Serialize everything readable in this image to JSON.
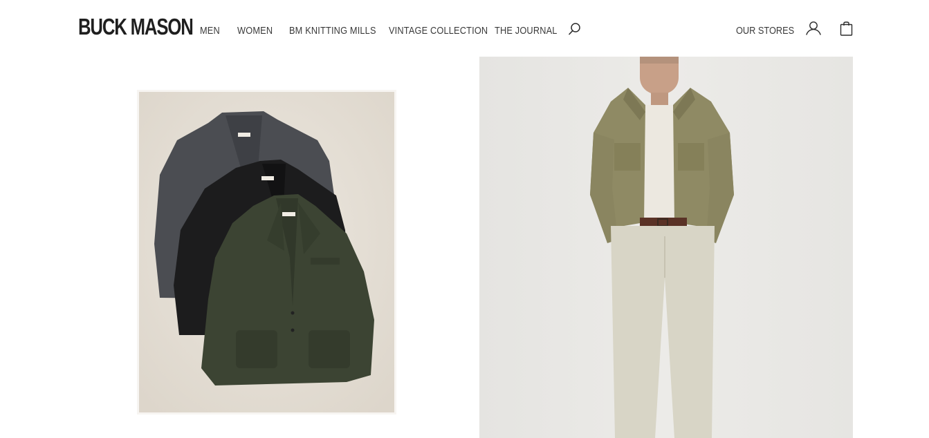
{
  "brand": {
    "logo_text": "BUCK MASON"
  },
  "nav": {
    "items": [
      {
        "label": "MEN"
      },
      {
        "label": "WOMEN"
      },
      {
        "label": "BM KNITTING MILLS"
      },
      {
        "label": "VINTAGE COLLECTION"
      },
      {
        "label": "THE JOURNAL"
      }
    ]
  },
  "header_right": {
    "stores_label": "OUR STORES"
  },
  "icons": {
    "search": "search-icon",
    "account": "user-icon",
    "bag": "shopping-bag-icon"
  },
  "colors": {
    "text": "#2b2b2b",
    "background": "#ffffff",
    "flatlay_background": "#e7e1d8",
    "model_background": "#e9e8e5"
  }
}
